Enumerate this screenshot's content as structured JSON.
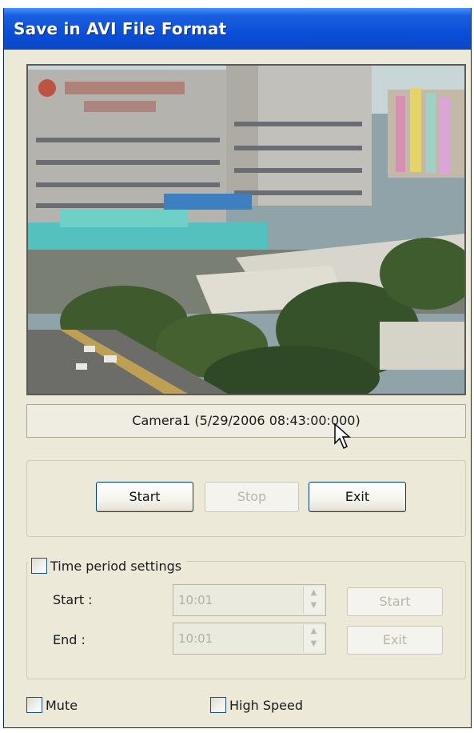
{
  "window": {
    "title": "Save in AVI File Format"
  },
  "preview": {
    "caption": "Camera1 (5/29/2006  08:43:00:000)"
  },
  "controls": {
    "start_label": "Start",
    "stop_label": "Stop",
    "exit_label": "Exit"
  },
  "time_period": {
    "checkbox_label": "Time period settings",
    "checked": false,
    "start_label": "Start :",
    "start_value": "10:01",
    "end_label": "End :",
    "end_value": "10:01",
    "start_button_label": "Start",
    "exit_button_label": "Exit"
  },
  "options": {
    "mute_label": "Mute",
    "mute_checked": false,
    "high_speed_label": "High Speed",
    "high_speed_checked": false
  }
}
